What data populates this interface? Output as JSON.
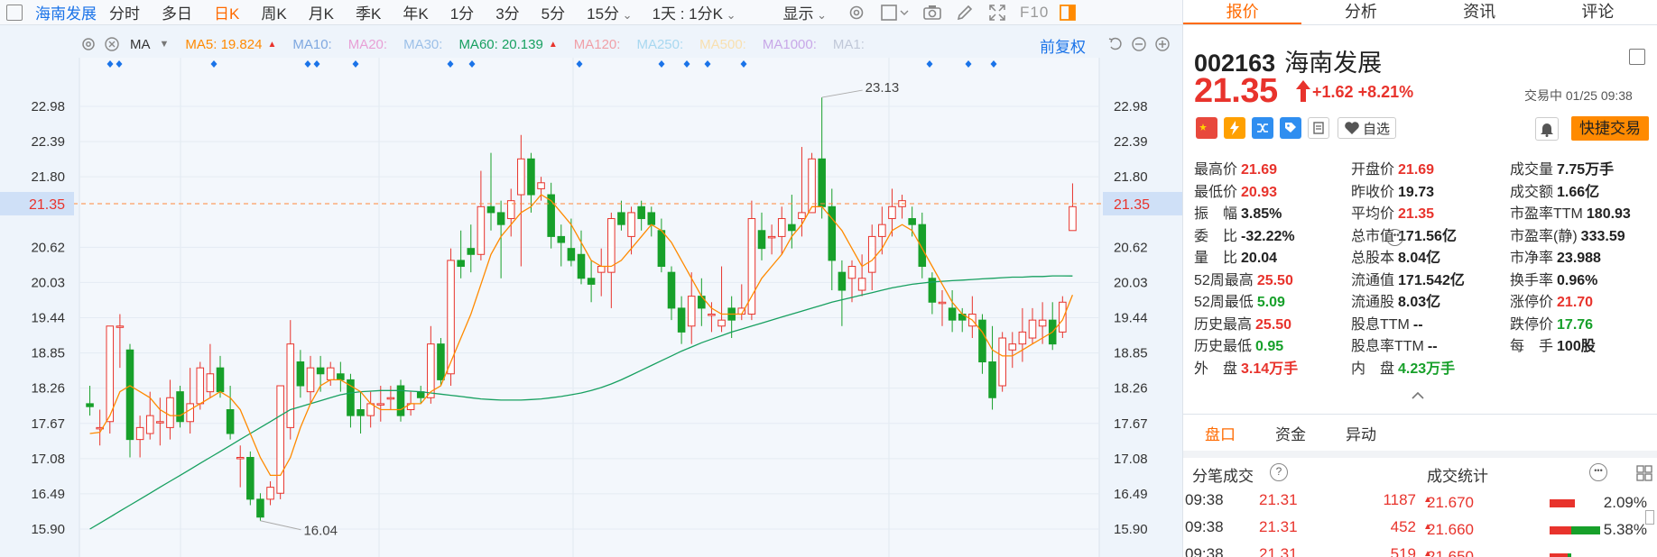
{
  "toolbar": {
    "stock_name": "海南发展",
    "periods": [
      "分时",
      "多日",
      "日K",
      "周K",
      "月K",
      "季K",
      "年K",
      "1分",
      "3分",
      "5分"
    ],
    "active_period": "日K",
    "period_select": "15分",
    "interval_select": "1天 : 1分K",
    "display_select": "显示",
    "f10_label": "F10",
    "icons": [
      "sidebar-icon",
      "gear-icon",
      "square-icon",
      "camera-icon",
      "pencil-icon",
      "expand-icon",
      "panel-icon"
    ]
  },
  "indicators": {
    "type": "MA",
    "items": [
      {
        "label": "MA5: 19.824",
        "color": "#ff8a00"
      },
      {
        "label": "MA10:",
        "color": "#7fa8e0"
      },
      {
        "label": "MA20:",
        "color": "#e8a0d6"
      },
      {
        "label": "MA30:",
        "color": "#9cc0e8"
      },
      {
        "label": "MA60: 20.139",
        "color": "#17a060"
      },
      {
        "label": "MA120:",
        "color": "#f0a0a8"
      },
      {
        "label": "MA250:",
        "color": "#a8d8f0"
      },
      {
        "label": "MA500:",
        "color": "#f8e0b0"
      },
      {
        "label": "MA1000:",
        "color": "#c8a8e8"
      },
      {
        "label": "MA1:",
        "color": "#c0c8d8"
      }
    ],
    "fuquan": "前复权",
    "colors": {
      "up": "#e8332c",
      "down": "#17a02a",
      "ma5": "#ff8a00",
      "ma60": "#17a060"
    }
  },
  "chart_data": {
    "type": "candlestick",
    "y_ticks_left": [
      "22.98",
      "22.39",
      "21.80",
      "20.62",
      "20.03",
      "19.44",
      "18.85",
      "18.26",
      "17.67",
      "17.08",
      "16.49",
      "15.90"
    ],
    "y_ticks_right": [
      "22.98",
      "22.39",
      "21.80",
      "20.62",
      "20.03",
      "19.44",
      "18.85",
      "18.26",
      "17.67",
      "17.08",
      "16.49",
      "15.90"
    ],
    "ylim": [
      15.9,
      22.98
    ],
    "current_price_label": "21.35",
    "high_annotation": "23.13",
    "low_annotation": "16.04",
    "candles": [
      [
        18.0,
        17.95,
        18.3,
        17.8
      ],
      [
        17.6,
        17.6,
        17.9,
        17.3
      ],
      [
        17.7,
        19.3,
        19.3,
        17.5
      ],
      [
        19.3,
        19.3,
        19.5,
        18.6
      ],
      [
        18.9,
        17.4,
        19.0,
        17.1
      ],
      [
        17.4,
        17.6,
        17.8,
        17.1
      ],
      [
        17.5,
        17.8,
        18.2,
        17.4
      ],
      [
        17.7,
        17.7,
        18.1,
        17.3
      ],
      [
        17.6,
        18.1,
        18.4,
        17.4
      ],
      [
        18.2,
        17.7,
        18.3,
        17.6
      ],
      [
        17.7,
        18.0,
        18.6,
        17.5
      ],
      [
        18.0,
        18.6,
        18.7,
        17.9
      ],
      [
        18.2,
        18.5,
        19.0,
        18.1
      ],
      [
        18.6,
        18.2,
        18.8,
        18.1
      ],
      [
        17.9,
        17.5,
        18.3,
        17.4
      ],
      [
        17.1,
        17.1,
        17.3,
        16.6
      ],
      [
        17.1,
        16.4,
        17.2,
        16.3
      ],
      [
        16.4,
        16.1,
        16.5,
        16.04
      ],
      [
        16.4,
        16.6,
        16.7,
        16.3
      ],
      [
        16.5,
        18.3,
        18.3,
        16.4
      ],
      [
        17.6,
        19.0,
        19.4,
        17.4
      ],
      [
        18.7,
        18.3,
        18.9,
        18.1
      ],
      [
        18.2,
        18.6,
        18.8,
        18.0
      ],
      [
        18.6,
        18.5,
        18.8,
        18.2
      ],
      [
        18.4,
        18.6,
        18.7,
        18.3
      ],
      [
        18.5,
        18.4,
        18.7,
        18.2
      ],
      [
        18.4,
        17.8,
        18.5,
        17.6
      ],
      [
        17.9,
        17.8,
        18.2,
        17.5
      ],
      [
        17.8,
        18.0,
        18.2,
        17.6
      ],
      [
        18.0,
        18.0,
        18.3,
        17.7
      ],
      [
        18.1,
        18.1,
        18.3,
        17.9
      ],
      [
        18.3,
        17.8,
        18.4,
        17.7
      ],
      [
        17.9,
        18.0,
        18.2,
        17.8
      ],
      [
        18.2,
        18.1,
        18.3,
        18.0
      ],
      [
        18.1,
        19.0,
        19.3,
        18.0
      ],
      [
        19.0,
        18.4,
        19.1,
        18.3
      ],
      [
        18.5,
        20.4,
        20.6,
        18.3
      ],
      [
        20.4,
        20.3,
        20.9,
        20.1
      ],
      [
        20.6,
        20.5,
        21.0,
        20.2
      ],
      [
        20.5,
        21.3,
        21.9,
        20.4
      ],
      [
        21.3,
        21.2,
        22.2,
        20.9
      ],
      [
        21.2,
        21.0,
        21.4,
        20.1
      ],
      [
        21.1,
        21.4,
        21.6,
        20.8
      ],
      [
        21.5,
        22.1,
        22.5,
        20.3
      ],
      [
        22.1,
        21.5,
        22.2,
        21.2
      ],
      [
        21.6,
        21.7,
        21.8,
        21.4
      ],
      [
        21.5,
        20.8,
        21.7,
        20.6
      ],
      [
        20.8,
        20.7,
        21.0,
        20.3
      ],
      [
        20.6,
        20.4,
        21.1,
        20.3
      ],
      [
        20.5,
        20.1,
        20.9,
        20.0
      ],
      [
        20.1,
        20.0,
        20.4,
        19.7
      ],
      [
        20.2,
        20.3,
        20.6,
        19.8
      ],
      [
        20.2,
        21.1,
        21.2,
        19.6
      ],
      [
        21.2,
        21.0,
        21.4,
        20.9
      ],
      [
        20.8,
        21.2,
        21.3,
        20.5
      ],
      [
        21.3,
        21.1,
        21.4,
        20.9
      ],
      [
        21.2,
        21.0,
        21.3,
        20.8
      ],
      [
        20.9,
        20.3,
        21.1,
        20.2
      ],
      [
        20.2,
        19.6,
        20.3,
        19.4
      ],
      [
        19.6,
        19.2,
        19.8,
        19.0
      ],
      [
        19.3,
        19.8,
        20.2,
        19.0
      ],
      [
        19.8,
        19.6,
        20.1,
        19.3
      ],
      [
        19.5,
        19.5,
        19.7,
        19.2
      ],
      [
        19.3,
        19.4,
        20.3,
        19.2
      ],
      [
        19.6,
        19.4,
        19.8,
        19.1
      ],
      [
        19.5,
        19.6,
        20.0,
        19.4
      ],
      [
        19.5,
        21.1,
        21.4,
        19.4
      ],
      [
        20.9,
        20.6,
        21.2,
        20.4
      ],
      [
        20.8,
        20.8,
        21.0,
        20.5
      ],
      [
        20.8,
        21.1,
        21.3,
        20.5
      ],
      [
        21.0,
        20.9,
        21.5,
        20.6
      ],
      [
        21.1,
        21.2,
        22.3,
        20.8
      ],
      [
        21.2,
        22.1,
        22.2,
        21.3
      ],
      [
        22.1,
        21.3,
        23.13,
        21.1
      ],
      [
        21.3,
        20.4,
        21.6,
        19.9
      ],
      [
        20.2,
        19.9,
        20.4,
        19.3
      ],
      [
        20.1,
        20.3,
        20.4,
        19.7
      ],
      [
        19.9,
        20.1,
        20.5,
        19.8
      ],
      [
        20.2,
        20.8,
        21.0,
        19.9
      ],
      [
        20.8,
        21.0,
        21.3,
        20.5
      ],
      [
        21.1,
        21.3,
        21.6,
        20.8
      ],
      [
        21.3,
        21.4,
        21.5,
        21.1
      ],
      [
        21.1,
        21.0,
        21.3,
        20.8
      ],
      [
        21.0,
        20.3,
        21.2,
        20.1
      ],
      [
        20.1,
        19.7,
        20.2,
        19.5
      ],
      [
        19.7,
        19.7,
        19.9,
        19.3
      ],
      [
        19.6,
        19.4,
        19.9,
        19.2
      ],
      [
        19.5,
        19.4,
        19.6,
        19.2
      ],
      [
        19.3,
        19.5,
        19.8,
        19.1
      ],
      [
        19.4,
        18.7,
        19.5,
        18.5
      ],
      [
        18.7,
        18.1,
        19.3,
        17.9
      ],
      [
        18.3,
        19.1,
        19.2,
        18.2
      ],
      [
        18.9,
        19.0,
        19.2,
        18.6
      ],
      [
        19.0,
        19.2,
        19.6,
        18.7
      ],
      [
        19.1,
        19.4,
        19.6,
        19.0
      ],
      [
        19.3,
        19.4,
        19.7,
        19.0
      ],
      [
        19.4,
        19.0,
        19.7,
        18.9
      ],
      [
        19.2,
        19.7,
        19.8,
        19.1
      ],
      [
        20.9,
        21.3,
        21.69,
        20.93
      ]
    ],
    "series": [
      {
        "name": "MA5",
        "values": [
          17.5,
          17.52,
          17.8,
          18.2,
          18.3,
          18.2,
          18.1,
          17.9,
          17.8,
          17.8,
          17.9,
          18.0,
          18.1,
          18.2,
          18.1,
          17.9,
          17.5,
          17.1,
          16.8,
          16.8,
          17.1,
          17.6,
          18.0,
          18.3,
          18.4,
          18.4,
          18.3,
          18.2,
          18.0,
          17.9,
          17.9,
          17.9,
          18.0,
          18.0,
          18.2,
          18.3,
          18.7,
          19.1,
          19.5,
          20.0,
          20.5,
          20.8,
          21.0,
          21.2,
          21.3,
          21.5,
          21.4,
          21.2,
          21.0,
          20.7,
          20.4,
          20.3,
          20.3,
          20.4,
          20.6,
          20.8,
          21.0,
          20.9,
          20.7,
          20.4,
          20.1,
          19.8,
          19.6,
          19.5,
          19.5,
          19.5,
          19.8,
          20.1,
          20.3,
          20.5,
          20.8,
          21.0,
          21.3,
          21.3,
          21.1,
          20.9,
          20.6,
          20.3,
          20.4,
          20.6,
          20.9,
          21.0,
          20.9,
          20.6,
          20.3,
          20.0,
          19.7,
          19.5,
          19.4,
          19.2,
          18.9,
          18.8,
          18.8,
          18.9,
          19.0,
          19.1,
          19.2,
          19.4,
          19.82
        ]
      },
      {
        "name": "MA60",
        "values": [
          15.9,
          16.0,
          16.1,
          16.2,
          16.3,
          16.4,
          16.5,
          16.6,
          16.7,
          16.8,
          16.9,
          17.0,
          17.1,
          17.2,
          17.3,
          17.4,
          17.5,
          17.6,
          17.7,
          17.8,
          17.9,
          17.95,
          18.0,
          18.05,
          18.1,
          18.15,
          18.18,
          18.2,
          18.21,
          18.22,
          18.22,
          18.22,
          18.21,
          18.2,
          18.18,
          18.16,
          18.14,
          18.12,
          18.1,
          18.08,
          18.07,
          18.06,
          18.06,
          18.06,
          18.07,
          18.08,
          18.1,
          18.12,
          18.15,
          18.18,
          18.22,
          18.27,
          18.33,
          18.4,
          18.48,
          18.56,
          18.64,
          18.72,
          18.8,
          18.88,
          18.95,
          19.02,
          19.08,
          19.14,
          19.2,
          19.25,
          19.3,
          19.35,
          19.4,
          19.45,
          19.5,
          19.55,
          19.6,
          19.65,
          19.7,
          19.74,
          19.78,
          19.82,
          19.86,
          19.9,
          19.94,
          19.97,
          20.0,
          20.02,
          20.04,
          20.05,
          20.06,
          20.07,
          20.08,
          20.09,
          20.1,
          20.11,
          20.12,
          20.12,
          20.13,
          20.13,
          20.14,
          20.14,
          20.139
        ]
      }
    ]
  },
  "tabs": [
    "报价",
    "分析",
    "资讯",
    "评论"
  ],
  "stock": {
    "code": "002163",
    "name": "海南发展",
    "price": "21.35",
    "change": "+1.62",
    "change_pct": "+8.21%",
    "trade_status": "交易中 01/25 09:38",
    "zixuan": "自选",
    "quick_trade": "快捷交易"
  },
  "quotes": {
    "col1": [
      {
        "k": "最高价",
        "v": "21.69",
        "c": "red"
      },
      {
        "k": "最低价",
        "v": "20.93",
        "c": "red"
      },
      {
        "k": "振　幅",
        "v": "3.85%",
        "c": "dark"
      },
      {
        "k": "委　比",
        "v": "-32.22%",
        "c": "dark"
      },
      {
        "k": "量　比",
        "v": "20.04",
        "c": "dark"
      },
      {
        "k": "52周最高",
        "v": "25.50",
        "c": "red"
      },
      {
        "k": "52周最低",
        "v": "5.09",
        "c": "green"
      },
      {
        "k": "历史最高",
        "v": "25.50",
        "c": "red"
      },
      {
        "k": "历史最低",
        "v": "0.95",
        "c": "green"
      },
      {
        "k": "外　盘",
        "v": "3.14万手",
        "c": "red"
      }
    ],
    "col2": [
      {
        "k": "开盘价",
        "v": "21.69",
        "c": "red"
      },
      {
        "k": "昨收价",
        "v": "19.73",
        "c": "dark"
      },
      {
        "k": "平均价",
        "v": "21.35",
        "c": "red"
      },
      {
        "k": "总市值",
        "v": "171.56亿",
        "c": "dark"
      },
      {
        "k": "总股本",
        "v": "8.04亿",
        "c": "dark"
      },
      {
        "k": "流通值",
        "v": "171.542亿",
        "c": "dark"
      },
      {
        "k": "流通股",
        "v": "8.03亿",
        "c": "dark"
      },
      {
        "k": "股息TTM",
        "v": "--",
        "c": "dark"
      },
      {
        "k": "股息率TTM",
        "v": "--",
        "c": "dark"
      },
      {
        "k": "内　盘",
        "v": "4.23万手",
        "c": "green"
      }
    ],
    "col3": [
      {
        "k": "成交量",
        "v": "7.75万手",
        "c": "dark"
      },
      {
        "k": "成交额",
        "v": "1.66亿",
        "c": "dark"
      },
      {
        "k": "市盈率TTM",
        "v": "180.93",
        "c": "dark"
      },
      {
        "k": "市盈率(静)",
        "v": "333.59",
        "c": "dark"
      },
      {
        "k": "市净率",
        "v": "23.988",
        "c": "dark"
      },
      {
        "k": "换手率",
        "v": "0.96%",
        "c": "dark"
      },
      {
        "k": "涨停价",
        "v": "21.70",
        "c": "red"
      },
      {
        "k": "跌停价",
        "v": "17.76",
        "c": "green"
      },
      {
        "k": "每　手",
        "v": "100股",
        "c": "dark"
      }
    ]
  },
  "subtabs": [
    "盘口",
    "资金",
    "异动"
  ],
  "ticks_header": "分笔成交",
  "stats_header": "成交统计",
  "ticks": [
    {
      "time": "09:38",
      "price": "21.31",
      "vol": "1187"
    },
    {
      "time": "09:38",
      "price": "21.31",
      "vol": "452"
    },
    {
      "time": "09:38",
      "price": "21.31",
      "vol": "519"
    }
  ],
  "stats": [
    {
      "price": "21.670",
      "pct": "2.09%"
    },
    {
      "price": "21.660",
      "pct": "5.38%"
    },
    {
      "price": "21.650",
      "pct": ""
    }
  ]
}
